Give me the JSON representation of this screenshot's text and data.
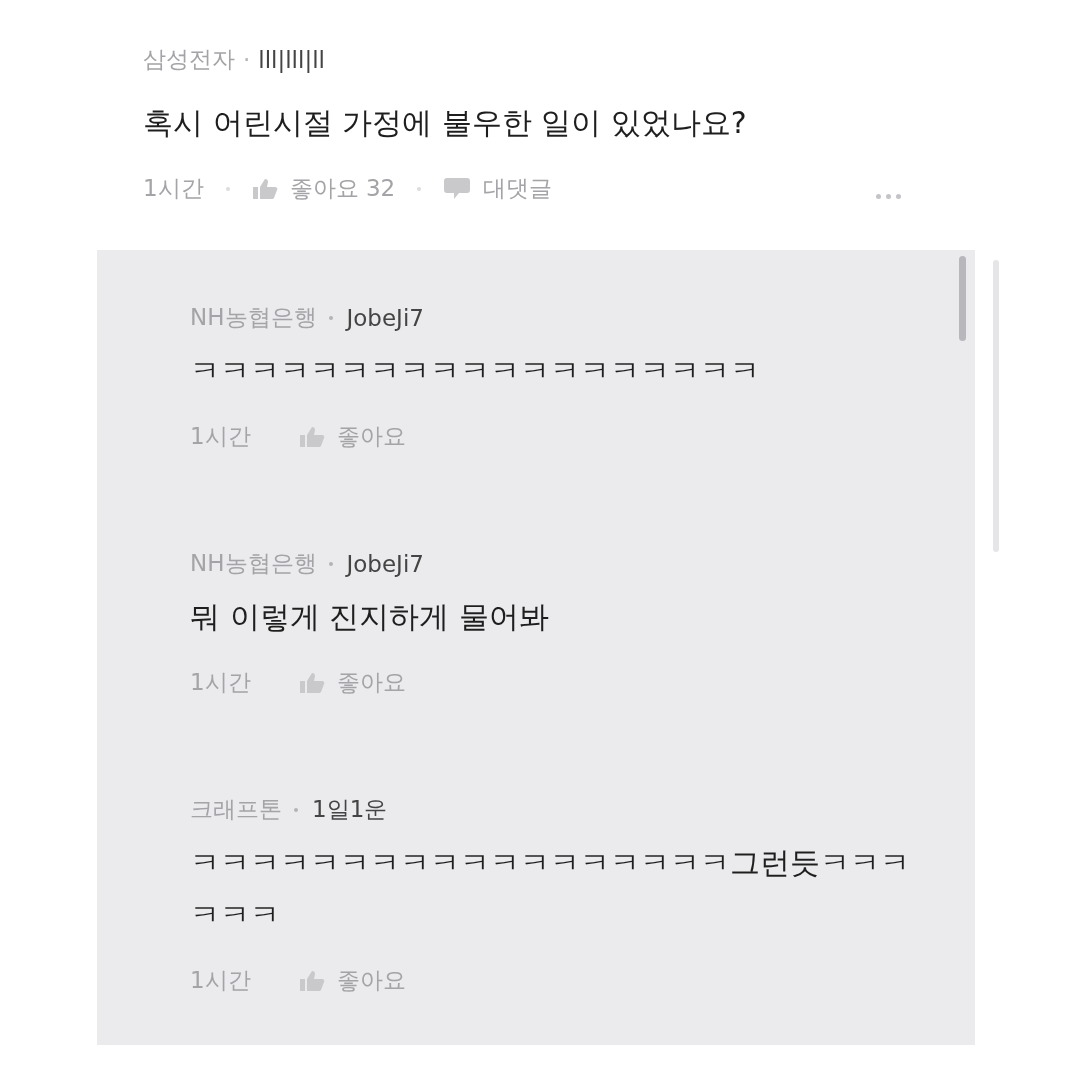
{
  "comment": {
    "company": "삼성전자",
    "author": "lll|lll|ll",
    "separator": "·",
    "text": "혹시 어린시절 가정에 불우한 일이 있었나요?",
    "time": "1시간",
    "like_label": "좋아요 32",
    "reply_label": "대댓글"
  },
  "replies": [
    {
      "company": "NH농협은행",
      "author": "JobeJi7",
      "text": "ㅋㅋㅋㅋㅋㅋㅋㅋㅋㅋㅋㅋㅋㅋㅋㅋㅋㅋㅋ",
      "time": "1시간",
      "like_label": "좋아요"
    },
    {
      "company": "NH농협은행",
      "author": "JobeJi7",
      "text": "뭐 이렇게 진지하게 물어봐",
      "time": "1시간",
      "like_label": "좋아요"
    },
    {
      "company": "크래프톤",
      "author": "1일1운",
      "text": "ㅋㅋㅋㅋㅋㅋㅋㅋㅋㅋㅋㅋㅋㅋㅋㅋㅋㅋ그런듯ㅋㅋㅋㅋㅋㅋ",
      "time": "1시간",
      "like_label": "좋아요"
    }
  ]
}
